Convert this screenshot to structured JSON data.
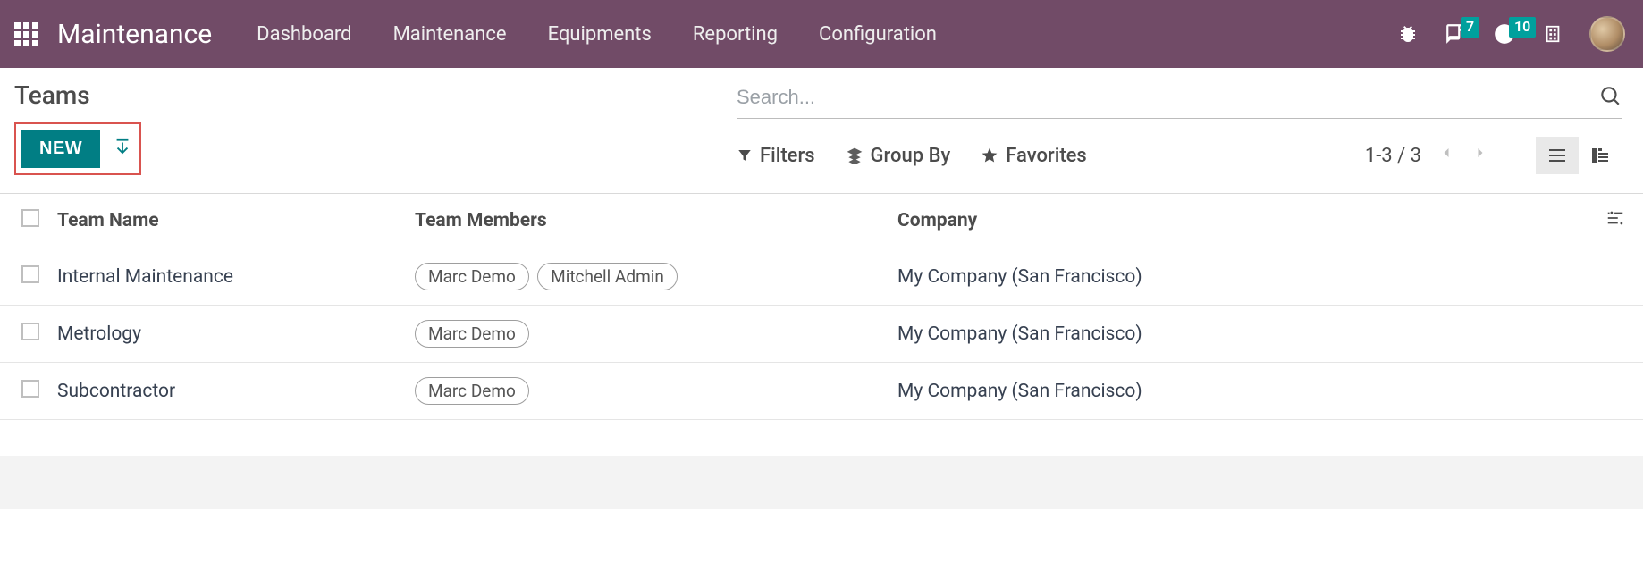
{
  "nav": {
    "brand": "Maintenance",
    "items": [
      "Dashboard",
      "Maintenance",
      "Equipments",
      "Reporting",
      "Configuration"
    ],
    "messages_badge": "7",
    "activities_badge": "10"
  },
  "header": {
    "title": "Teams",
    "new_button": "NEW"
  },
  "search": {
    "placeholder": "Search..."
  },
  "toolbar": {
    "filters": "Filters",
    "groupby": "Group By",
    "favorites": "Favorites",
    "pager": "1-3 / 3"
  },
  "table": {
    "columns": {
      "name": "Team Name",
      "members": "Team Members",
      "company": "Company"
    },
    "rows": [
      {
        "name": "Internal Maintenance",
        "members": [
          "Marc Demo",
          "Mitchell Admin"
        ],
        "company": "My Company (San Francisco)"
      },
      {
        "name": "Metrology",
        "members": [
          "Marc Demo"
        ],
        "company": "My Company (San Francisco)"
      },
      {
        "name": "Subcontractor",
        "members": [
          "Marc Demo"
        ],
        "company": "My Company (San Francisco)"
      }
    ]
  }
}
